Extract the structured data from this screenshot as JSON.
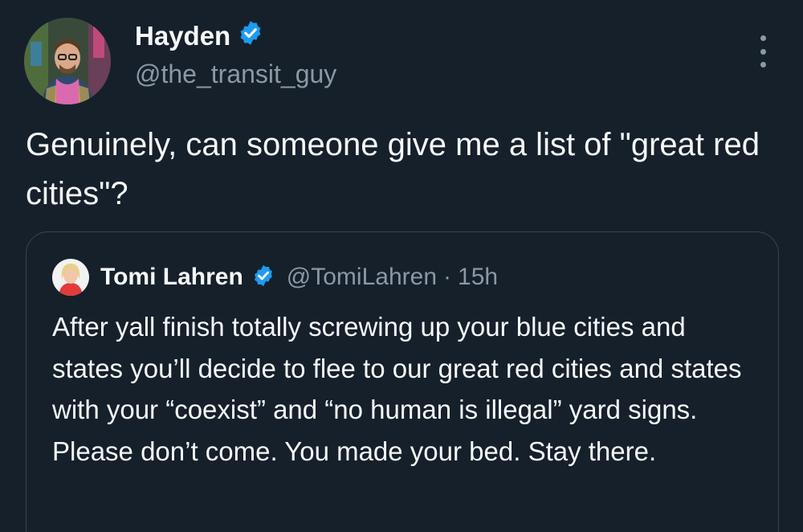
{
  "author": {
    "name": "Hayden",
    "handle": "@the_transit_guy",
    "verified": true
  },
  "tweet": {
    "text": "Genuinely, can someone give me a list of \"great red cities\"?"
  },
  "quoted": {
    "name": "Tomi Lahren",
    "handle": "@TomiLahren",
    "separator": "·",
    "time": "15h",
    "verified": true,
    "text": "After yall finish totally screwing up your blue cities and states you’ll decide to flee to our great red cities and states with your “coexist” and “no human is illegal” yard signs. Please don’t come. You made your bed. Stay there."
  },
  "icons": {
    "verified": "verified-badge-icon",
    "more": "more-options-icon"
  },
  "colors": {
    "background": "#15202b",
    "text": "#f7f9f9",
    "secondary": "#8b98a5",
    "verified": "#1d9bf0",
    "border": "#38444d"
  }
}
